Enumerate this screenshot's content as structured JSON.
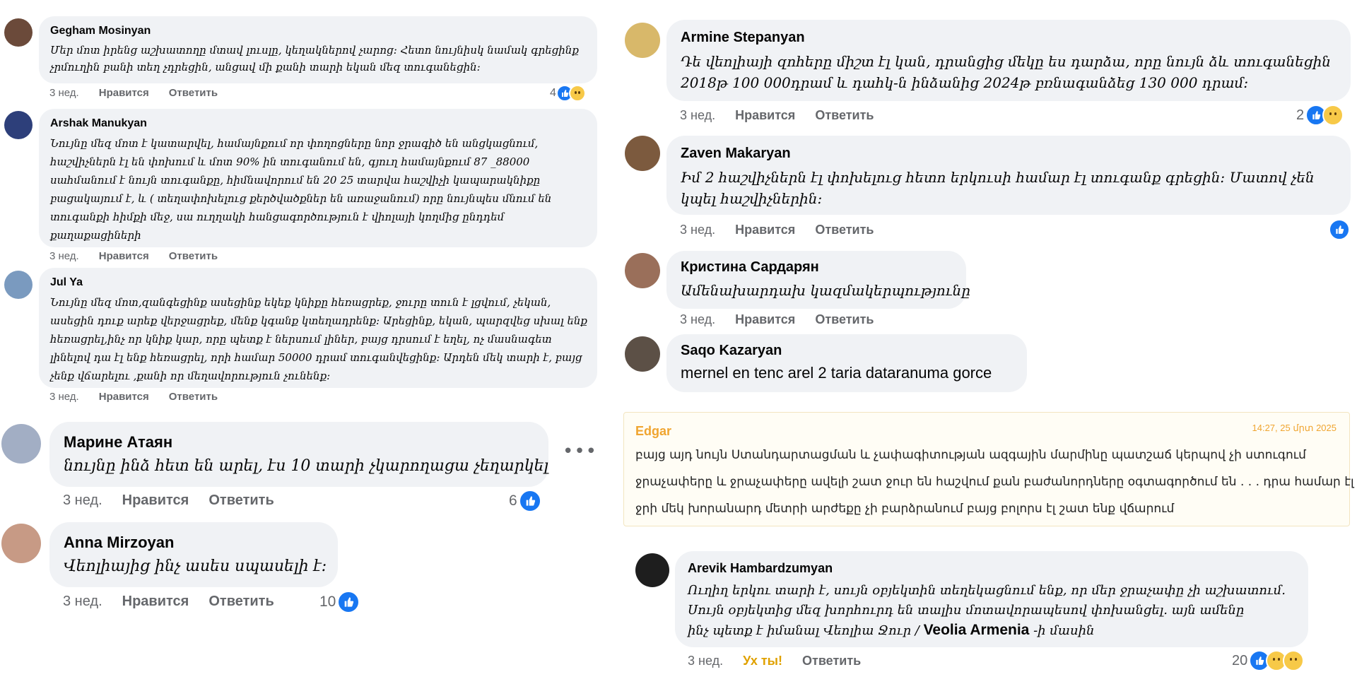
{
  "left": {
    "comments": [
      {
        "name": "Gegham Mosinyan",
        "text": "Մեր մոտ իրենց աշխատողը մտավ լուսլը, կեղակներով չարոց։ Հետո նույնիսկ նամակ գրեցինք չրմուղին բանի տեղ չդրեցին, անցավ մի քանի տարի եկան մեզ տուգանեցին։",
        "time": "3 нед.",
        "like": "Нравится",
        "reply": "Ответить",
        "count": "4"
      },
      {
        "name": "Arshak Manukyan",
        "text": "Նույնը մեզ մոտ է կատարվել, համայնքում որ փողոցները նոր ջրագիծ են անցկացնում, հաշվիչներն էլ են փոխում և մոտ 90% ին տուգանում են, գյուղ համայնքում 87 _88000 սահմանում է նույն տուգանքը, հիմնավորում են 20 25 տարվա հաշվիչի կապարակնիքը բացակայում է, և ( տեղափոխելուց քերծվածքներ են առաջանում) որը նույնպես մնում են տուգանքի հիմքի մեջ, սա ուղղակի հանցագործություն է վիոլայի կողմից ընդդեմ քաղաքացիների",
        "time": "3 нед.",
        "like": "Нравится",
        "reply": "Ответить"
      },
      {
        "name": "Jul Ya",
        "text": "Նույնը մեզ մոտ,զանգեցինք ասեցինք եկեք կնիքը հեռացրեք, ջուրը տուն է լցվում, չեկան, ասեցին դուք արեք վերջացրեք, մենք կգանք կտեղադրենք։ Արեցինք, եկան, պարզվեց սխալ ենք հեռացրել,ինչ որ կնիք կար, որը պետք է ներսում լիներ, բայց դրսում է եղել, ոչ մասնագետ լինելով դա էլ ենք հեռացրել, որի համար 50000 դրամ տուգանվեցինք։ Արդեն մեկ տարի է, բայց չենք վճարելու ,քանի որ մեղավորություն չունենք։",
        "time": "3 нед.",
        "like": "Нравится",
        "reply": "Ответить"
      },
      {
        "name": "Марине Атаян",
        "text": "նույնը ինձ հետ են արել, էս 10 տարի չկարողացա չեղարկել",
        "time": "3 нед.",
        "like": "Нравится",
        "reply": "Ответить",
        "count": "6"
      },
      {
        "name": "Anna Mirzoyan",
        "text": "Վեոլիայից ինչ ասես սպասելի է։",
        "time": "3 нед.",
        "like": "Нравится",
        "reply": "Ответить",
        "count": "10"
      }
    ]
  },
  "right": {
    "comments": [
      {
        "name": "Armine Stepanyan",
        "text": "Դե վեոլիայի զոհերը միշտ էլ կան, դրանցից մեկը ես դարձա, որը նույն ձև տուգանեցին 2018թ 100 000դրամ և դահկ-ն ինձանից 2024թ բռնագանձեց 130 000 դրամ։",
        "time": "3 нед.",
        "like": "Нравится",
        "reply": "Ответить",
        "count": "2"
      },
      {
        "name": "Zaven Makaryan",
        "text": "Իմ 2 հաշվիչներն էլ փոխելուց հետո երկուսի համար էլ տուգանք գրեցին։ Մատով չեն կպել հաշվիչներին։",
        "time": "3 нед.",
        "like": "Нравится",
        "reply": "Ответить"
      },
      {
        "name": "Кристина Сардарян",
        "text": "Ամենախարդախ կազմակերպությունը",
        "time": "3 нед.",
        "like": "Нравится",
        "reply": "Ответить"
      },
      {
        "name": "Saqo Kazaryan",
        "text": "mernel en tenc arel 2 taria dataranuma gorce"
      }
    ],
    "edgar": {
      "name": "Edgar",
      "timestamp": "14:27, 25 մրտ 2025",
      "lines": [
        "բայց այդ նույն Ստանդարտացման և չափագիտության ազգային մարմինը պատշաճ կերպով չի ստուգում",
        "ջրաչափերը և ջրաչափերը ավելի շատ ջուր են հաշվում քան բաժանորդները օգտագործում են . . . դրա համար էլ",
        "ջրի մեկ խորանարդ մետրի արժեքը չի բարձրանում բայց բոլորս էլ շատ ենք վճարում"
      ]
    },
    "arevik": {
      "name": "Arevik Hambardzumyan",
      "line1": "Ուղիղ երկու տարի է, սույն օբյեկտին տեղեկացնում ենք, որ մեր ջրաչափը չի աշխատում.",
      "line2": "Սույն օբյեկտից մեզ խորհուրդ են տալիս մոտավորապեսով փոխանցել. այն ամենը",
      "line3a": "ինչ պետք է իմանալ Վեոլիա Ջուր / ",
      "line3b": "Veolia Armenia",
      "line3c": " -ի մասին",
      "time": "3 нед.",
      "reaction_label": "Ух ты!",
      "reply": "Ответить",
      "count": "20"
    }
  },
  "colors": {
    "bubble": "#f0f2f5",
    "like": "#1877f2",
    "meta": "#65676b",
    "edgar_name": "#f0a530",
    "edgar_bg": "#fffdf5"
  }
}
